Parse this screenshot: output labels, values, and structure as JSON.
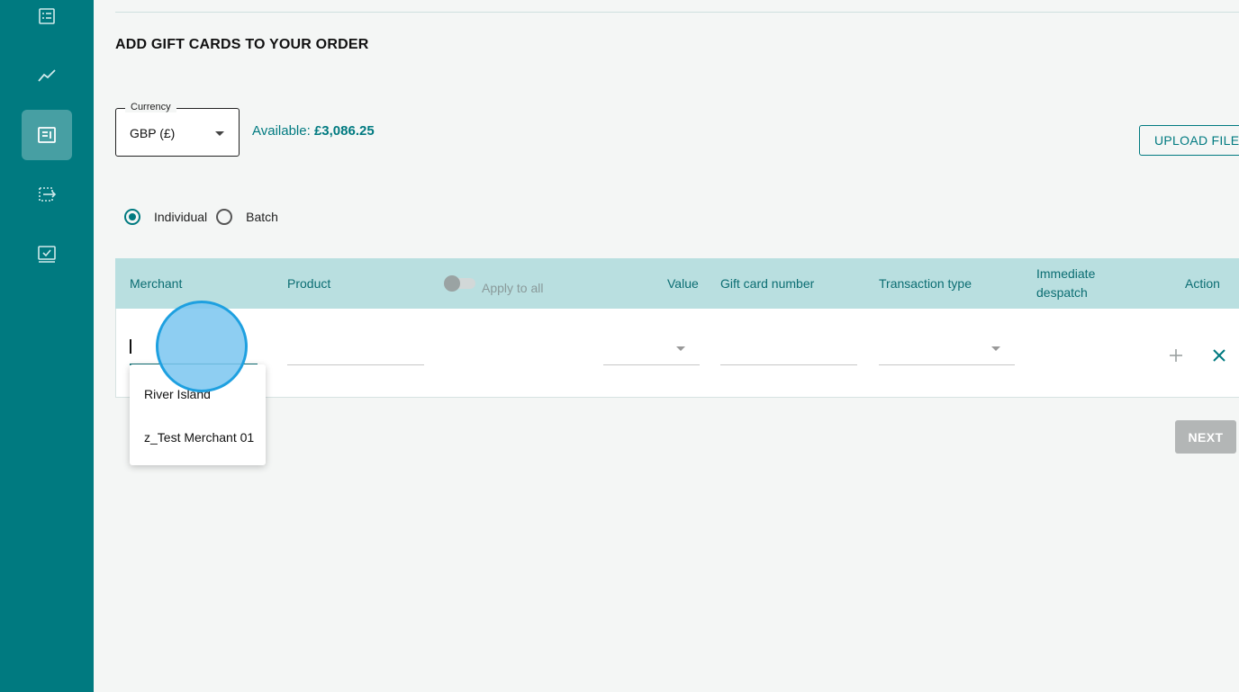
{
  "sidebar": {
    "items": [
      {
        "icon": "list-icon"
      },
      {
        "icon": "trend-chart-icon"
      },
      {
        "icon": "order-form-icon",
        "active": true
      },
      {
        "icon": "transfer-icon"
      },
      {
        "icon": "checklist-icon"
      }
    ]
  },
  "page": {
    "title": "ADD GIFT CARDS TO YOUR ORDER"
  },
  "currency": {
    "label": "Currency",
    "value": "GBP (£)"
  },
  "available": {
    "label": "Available:",
    "amount": "£3,086.25"
  },
  "upload_button": "UPLOAD FILE",
  "mode": {
    "options": [
      {
        "label": "Individual",
        "selected": true
      },
      {
        "label": "Batch",
        "selected": false
      }
    ]
  },
  "table": {
    "headers": {
      "merchant": "Merchant",
      "product": "Product",
      "apply_to_all": "Apply to all",
      "value": "Value",
      "gift_card_number": "Gift card number",
      "transaction_type": "Transaction type",
      "immediate_despatch_1": "Immediate",
      "immediate_despatch_2": "despatch",
      "action": "Action"
    },
    "apply_to_all_on": false
  },
  "merchant_dropdown": {
    "options": [
      "River Island",
      "z_Test Merchant 01"
    ]
  },
  "next_button": "NEXT",
  "colors": {
    "brand": "#007a80",
    "header_bg": "#b9dfe0",
    "click_indicator": "#7ac6f0"
  }
}
